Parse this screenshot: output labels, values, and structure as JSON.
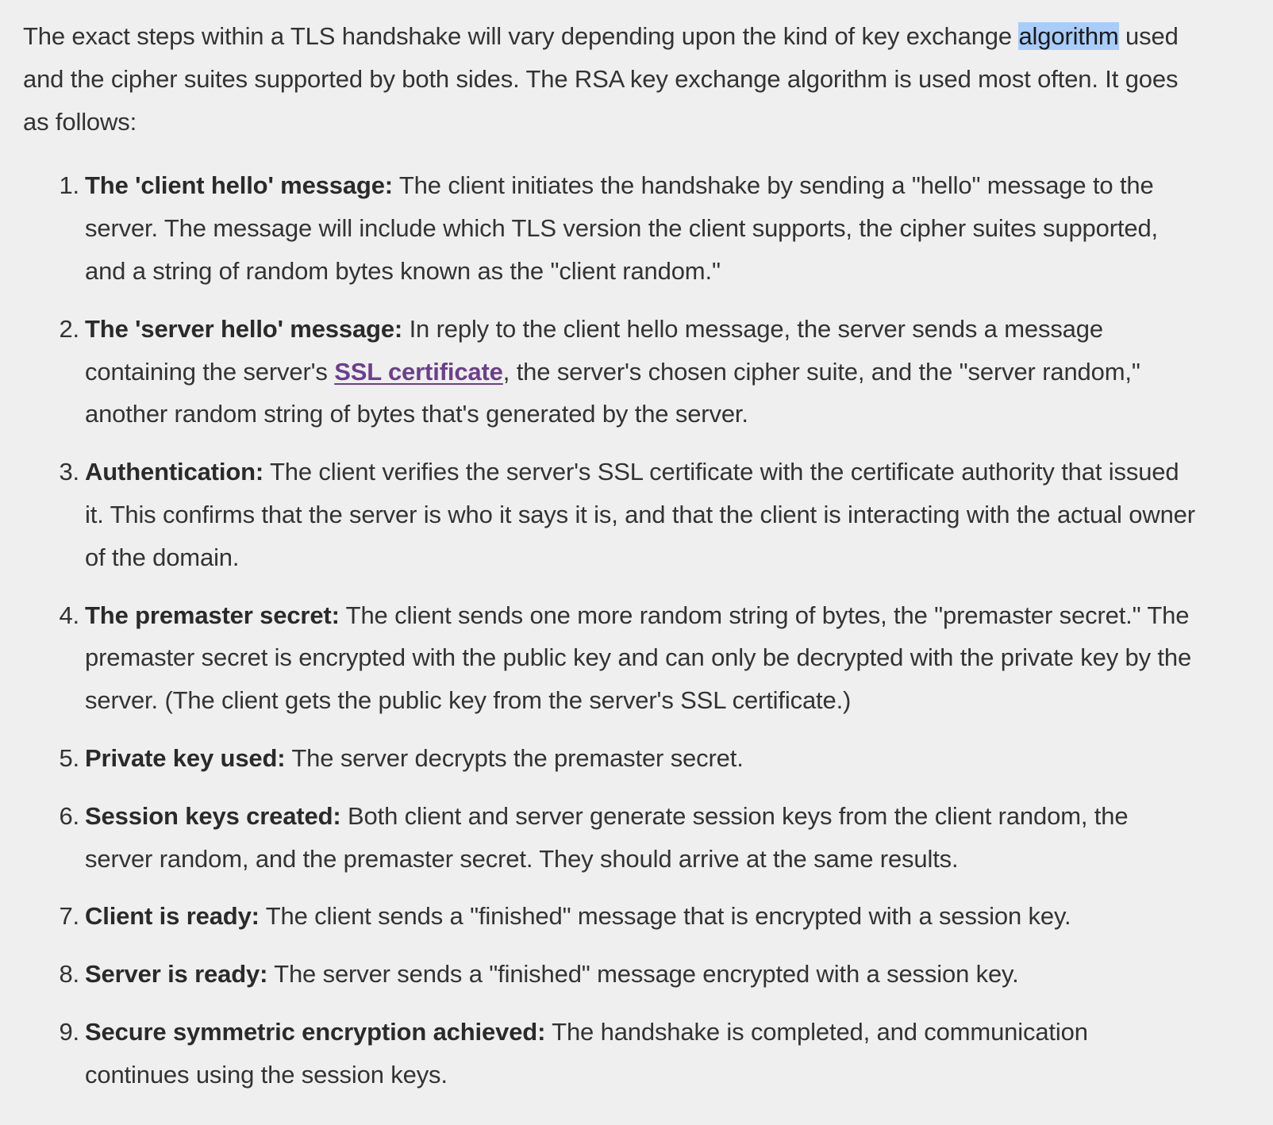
{
  "intro": {
    "text_before": "The exact steps within a TLS handshake will vary depending upon the kind of key exchange ",
    "highlighted": "algorithm",
    "text_after": " used and the cipher suites supported by both sides. The RSA key exchange algorithm is used most often. It goes as follows:"
  },
  "steps": [
    {
      "num": "1.",
      "title": "The 'client hello' message:",
      "text": " The client initiates the handshake by sending a \"hello\" message to the server. The message will include which TLS version the client supports, the cipher suites supported, and a string of random bytes known as the \"client random.\""
    },
    {
      "num": "2.",
      "title": "The 'server hello' message:",
      "text_before": " In reply to the client hello message, the server sends a message containing the server's ",
      "link": "SSL certificate",
      "text_after": ", the server's chosen cipher suite, and the \"server random,\" another random string of bytes that's generated by the server."
    },
    {
      "num": "3.",
      "title": "Authentication:",
      "text": " The client verifies the server's SSL certificate with the certificate authority that issued it. This confirms that the server is who it says it is, and that the client is interacting with the actual owner of the domain."
    },
    {
      "num": "4.",
      "title": "The premaster secret:",
      "text": " The client sends one more random string of bytes, the \"premaster secret.\" The premaster secret is encrypted with the public key and can only be decrypted with the private key by the server. (The client gets the public key from the server's SSL certificate.)"
    },
    {
      "num": "5.",
      "title": "Private key used:",
      "text": " The server decrypts the premaster secret."
    },
    {
      "num": "6.",
      "title": "Session keys created:",
      "text": " Both client and server generate session keys from the client random, the server random, and the premaster secret. They should arrive at the same results."
    },
    {
      "num": "7.",
      "title": "Client is ready:",
      "text": " The client sends a \"finished\" message that is encrypted with a session key."
    },
    {
      "num": "8.",
      "title": "Server is ready:",
      "text": " The server sends a \"finished\" message encrypted with a session key."
    },
    {
      "num": "9.",
      "title": "Secure symmetric encryption achieved:",
      "text": " The handshake is completed, and communication continues using the session keys."
    }
  ],
  "colors": {
    "background": "#efefef",
    "text": "#333333",
    "selection_highlight": "#a8cdfa",
    "visited_link": "#6b3f8c"
  }
}
